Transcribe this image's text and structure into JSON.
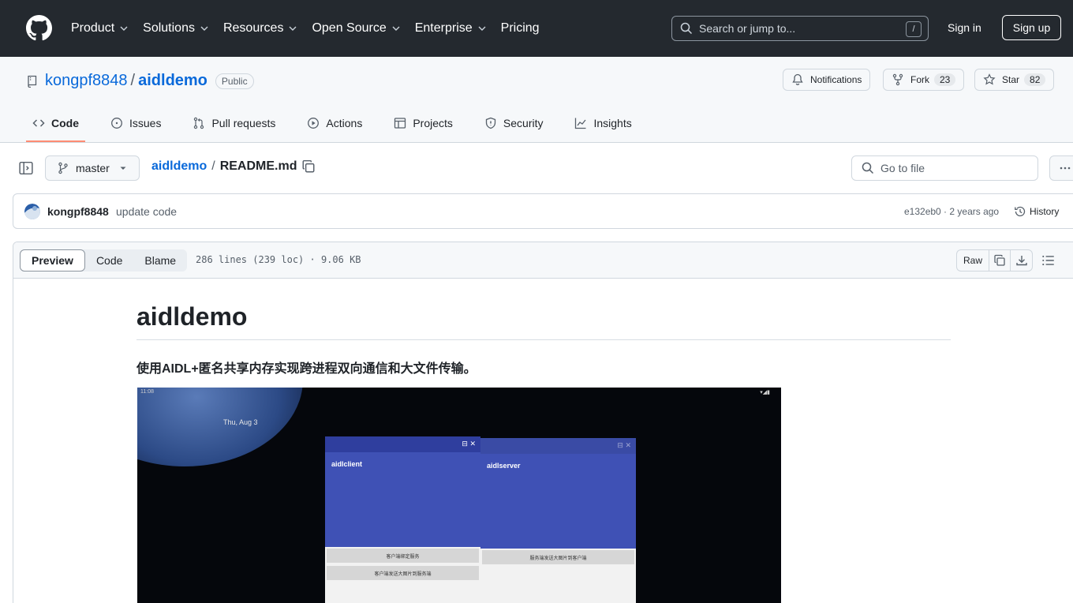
{
  "header": {
    "nav": [
      {
        "label": "Product",
        "has_menu": true
      },
      {
        "label": "Solutions",
        "has_menu": true
      },
      {
        "label": "Resources",
        "has_menu": true
      },
      {
        "label": "Open Source",
        "has_menu": true
      },
      {
        "label": "Enterprise",
        "has_menu": true
      },
      {
        "label": "Pricing",
        "has_menu": false
      }
    ],
    "search_placeholder": "Search or jump to...",
    "search_shortcut": "/",
    "sign_in": "Sign in",
    "sign_up": "Sign up"
  },
  "repo": {
    "owner": "kongpf8848",
    "separator": "/",
    "name": "aidldemo",
    "visibility": "Public",
    "notifications_label": "Notifications",
    "fork_label": "Fork",
    "fork_count": "23",
    "star_label": "Star",
    "star_count": "82",
    "tabs": [
      {
        "label": "Code",
        "icon": "code-icon",
        "active": true
      },
      {
        "label": "Issues",
        "icon": "issue-icon",
        "active": false
      },
      {
        "label": "Pull requests",
        "icon": "pull-request-icon",
        "active": false
      },
      {
        "label": "Actions",
        "icon": "play-icon",
        "active": false
      },
      {
        "label": "Projects",
        "icon": "table-icon",
        "active": false
      },
      {
        "label": "Security",
        "icon": "shield-icon",
        "active": false
      },
      {
        "label": "Insights",
        "icon": "graph-icon",
        "active": false
      }
    ]
  },
  "filenav": {
    "branch": "master",
    "crumb_repo": "aidldemo",
    "crumb_sep": "/",
    "crumb_file": "README.md",
    "goto_placeholder": "Go to file"
  },
  "commit": {
    "author": "kongpf8848",
    "message": "update code",
    "meta": "e132eb0 · 2 years ago",
    "history_label": "History"
  },
  "file": {
    "tabs": [
      {
        "label": "Preview",
        "active": true
      },
      {
        "label": "Code",
        "active": false
      },
      {
        "label": "Blame",
        "active": false
      }
    ],
    "info": "286 lines (239 loc) · 9.06 KB",
    "raw_label": "Raw"
  },
  "readme": {
    "title": "aidldemo",
    "subtitle": "使用AIDL+匿名共享内存实现跨进程双向通信和大文件传输。"
  },
  "screenshot": {
    "time": "11:08",
    "status": "▾◢▮",
    "date": "Thu, Aug 3",
    "client": {
      "title": "aidlclient",
      "window_icons": "⊟   ✕",
      "buttons": [
        "客户端绑定服务",
        "客户端发送大图片到服务端"
      ]
    },
    "server": {
      "title": "aidlserver",
      "window_icons": "⊟   ✕",
      "buttons": [
        "服务端发送大图片到客户端"
      ]
    }
  },
  "colors": {
    "header_bg": "#24292f",
    "link": "#0969da",
    "active_tab_underline": "#fd8c73",
    "app_primary": "#3f51b5"
  }
}
